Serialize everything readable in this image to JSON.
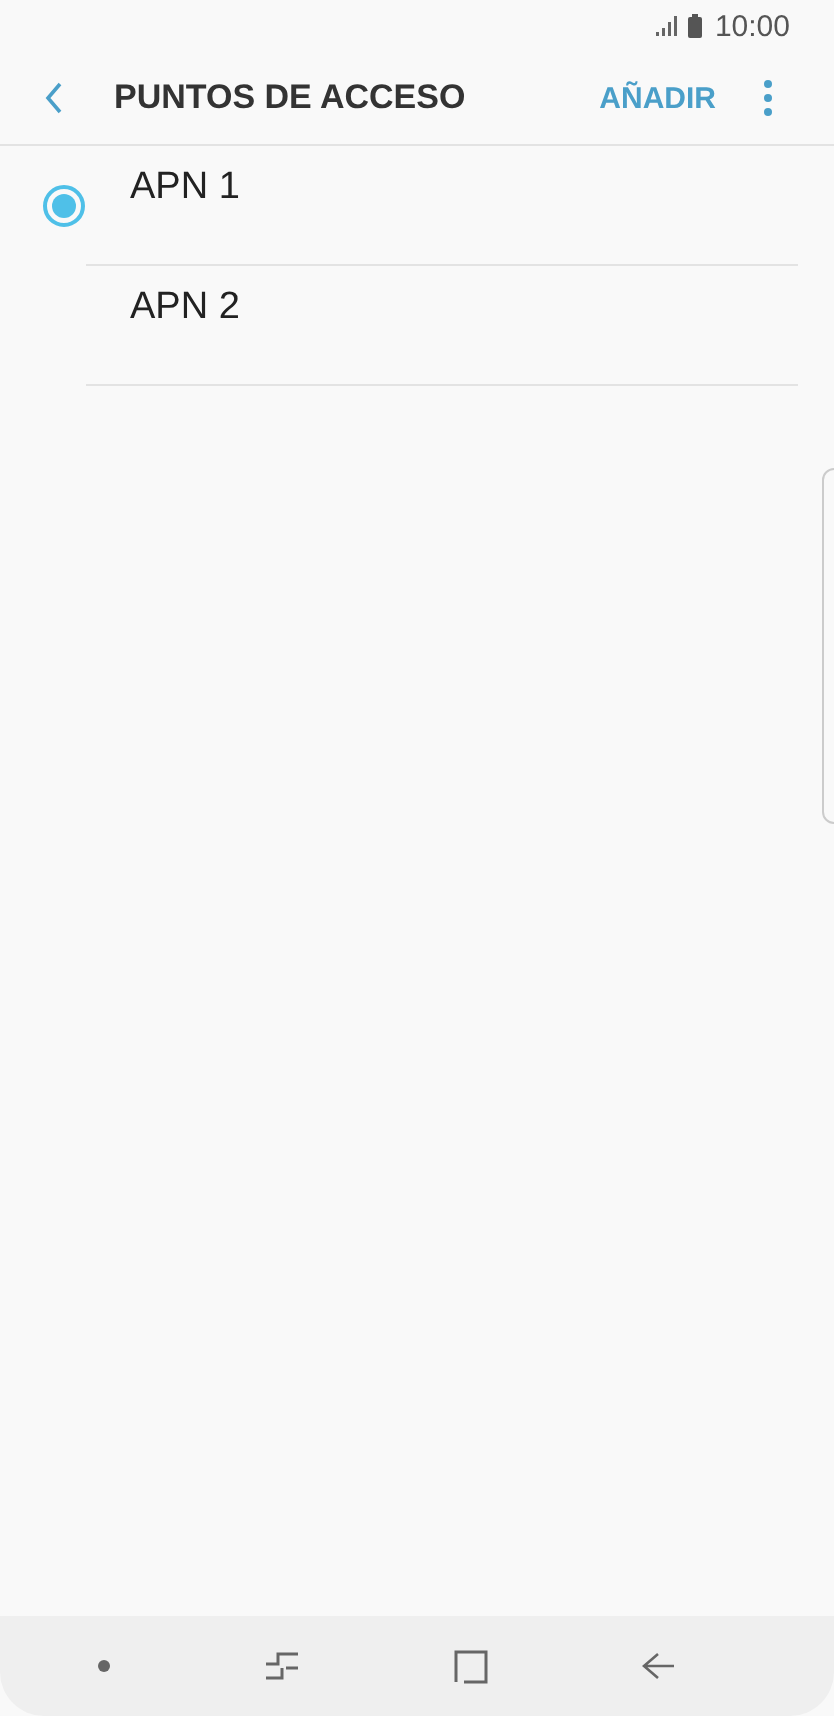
{
  "status_bar": {
    "time": "10:00"
  },
  "header": {
    "title": "PUNTOS DE ACCESO",
    "action": "AÑADIR"
  },
  "apns": [
    {
      "name": "APN 1",
      "selected": true
    },
    {
      "name": "APN 2",
      "selected": false
    }
  ]
}
